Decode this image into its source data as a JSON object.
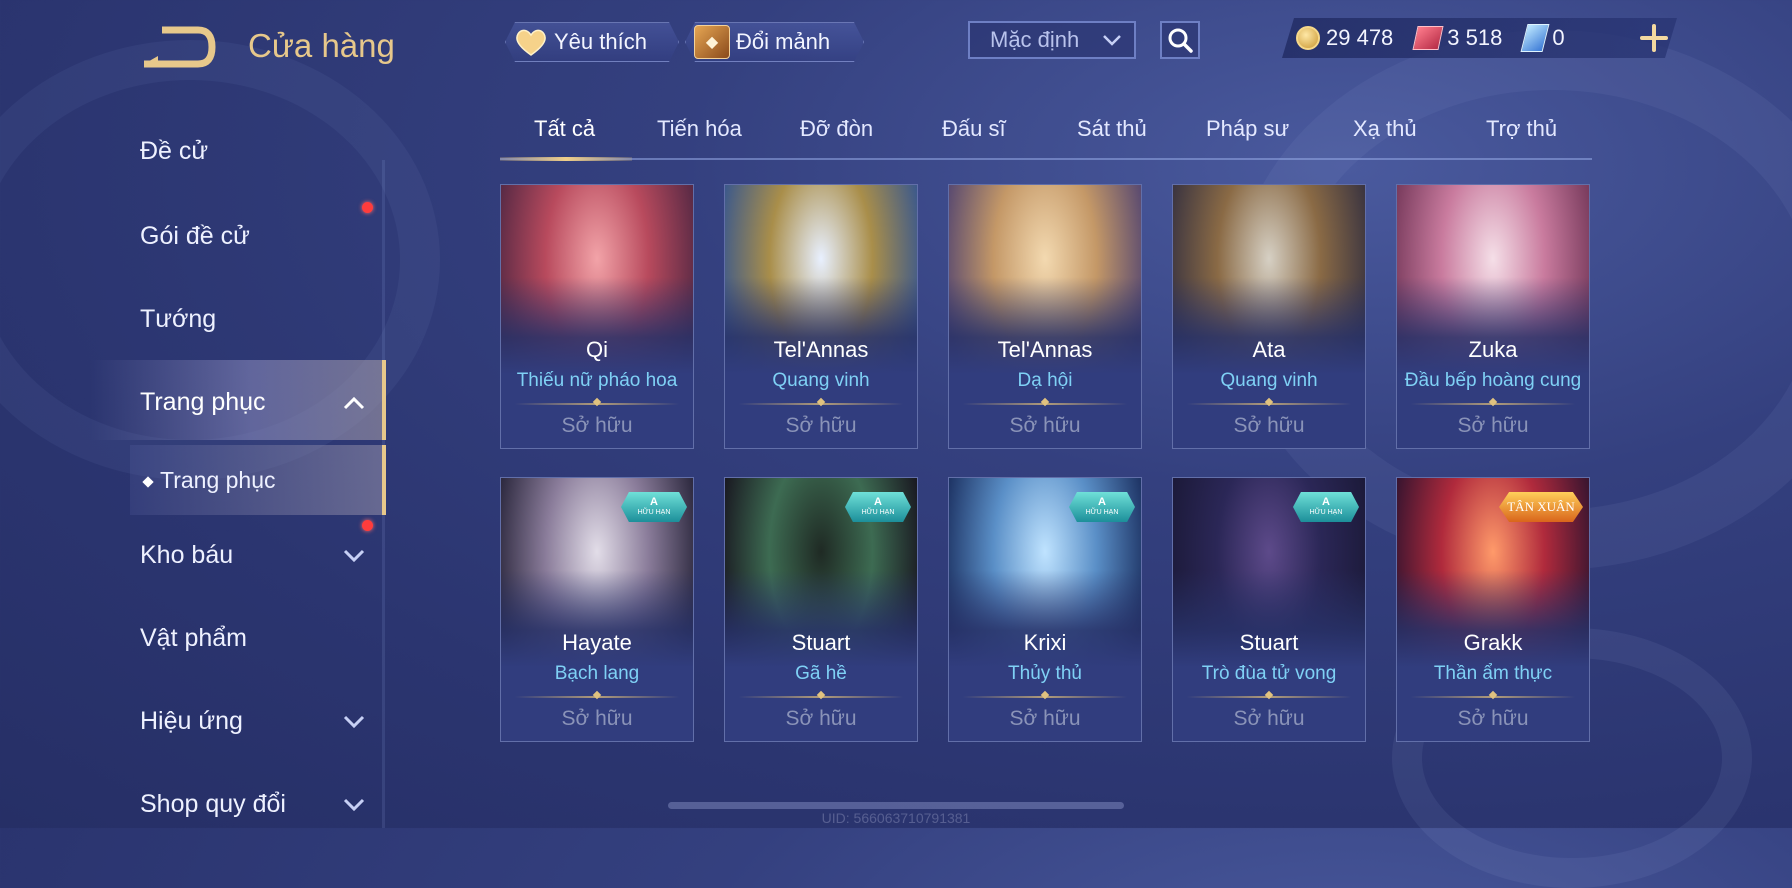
{
  "header": {
    "title": "Cửa hàng",
    "favorite_label": "Yêu thích",
    "exchange_label": "Đổi mảnh",
    "sort_value": "Mặc định",
    "currencies": [
      {
        "icon": "gold-coin-icon",
        "value": "29 478"
      },
      {
        "icon": "voucher-icon",
        "value": "3 518"
      },
      {
        "icon": "gem-icon",
        "value": "0"
      }
    ]
  },
  "sidebar": {
    "items": [
      {
        "label": "Đề cử"
      },
      {
        "label": "Gói đề cử"
      },
      {
        "label": "Tướng"
      },
      {
        "label": "Trang phục"
      },
      {
        "label": "Trang phục"
      },
      {
        "label": "Kho báu"
      },
      {
        "label": "Vật phẩm"
      },
      {
        "label": "Hiệu ứng"
      },
      {
        "label": "Shop quy đổi"
      }
    ]
  },
  "tabs": [
    "Tất cả",
    "Tiến hóa",
    "Đỡ đòn",
    "Đấu sĩ",
    "Sát thủ",
    "Pháp sư",
    "Xạ thủ",
    "Trợ thủ"
  ],
  "cards": [
    {
      "hero": "Qi",
      "skin": "Thiếu nữ pháo hoa",
      "status": "Sở hữu",
      "colors": [
        "#f2a3a8",
        "#b84a5d",
        "#5a2a45"
      ]
    },
    {
      "hero": "Tel'Annas",
      "skin": "Quang vinh",
      "status": "Sở hữu",
      "colors": [
        "#e8f0ff",
        "#a98e4a",
        "#3e5a8a"
      ]
    },
    {
      "hero": "Tel'Annas",
      "skin": "Dạ hội",
      "status": "Sở hữu",
      "colors": [
        "#f3d9b0",
        "#c49867",
        "#5b4b70"
      ]
    },
    {
      "hero": "Ata",
      "skin": "Quang vinh",
      "status": "Sở hữu",
      "colors": [
        "#d6d0c4",
        "#8a6a45",
        "#3c3540"
      ]
    },
    {
      "hero": "Zuka",
      "skin": "Đầu bếp hoàng cung",
      "status": "Sở hữu",
      "colors": [
        "#f5dfe8",
        "#c97b9e",
        "#7a3c5e"
      ]
    },
    {
      "hero": "Hayate",
      "skin": "Bạch lang",
      "status": "Sở hữu",
      "badge": {
        "top": "A",
        "bottom": "HỮU HẠN"
      },
      "colors": [
        "#e2dde8",
        "#8a7c9a",
        "#2e2a40"
      ]
    },
    {
      "hero": "Stuart",
      "skin": "Gã hề",
      "status": "Sở hữu",
      "badge": {
        "top": "A",
        "bottom": "HỮU HẠN"
      },
      "colors": [
        "#1f2a24",
        "#3d6b52",
        "#1a1a22"
      ]
    },
    {
      "hero": "Krixi",
      "skin": "Thủy thủ",
      "status": "Sở hữu",
      "badge": {
        "top": "A",
        "bottom": "HỮU HẠN"
      },
      "colors": [
        "#bfe3ff",
        "#5a8fc7",
        "#1f3566"
      ]
    },
    {
      "hero": "Stuart",
      "skin": "Trò đùa tử vong",
      "status": "Sở hữu",
      "badge": {
        "top": "A",
        "bottom": "HỮU HẠN"
      },
      "colors": [
        "#5d4a8a",
        "#2b2757",
        "#1c1a3a"
      ]
    },
    {
      "hero": "Grakk",
      "skin": "Thần ẩm thực",
      "status": "Sở hữu",
      "badge_text": "TÂN XUÂN",
      "colors": [
        "#ff9a6a",
        "#b02a3c",
        "#3a1530"
      ]
    }
  ],
  "footer": {
    "uid": "UID: 566063710791381"
  },
  "colors": {
    "accent_gold": "#e7c88b",
    "skin_text": "#7fd1f5",
    "background": "#34407f"
  }
}
